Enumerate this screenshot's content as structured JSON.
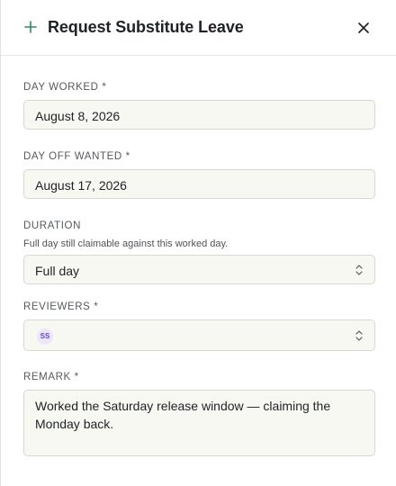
{
  "dialog": {
    "title": "Request Substitute Leave"
  },
  "fields": {
    "day_worked": {
      "label": "DAY WORKED",
      "required_mark": "*",
      "value": "August 8, 2026"
    },
    "day_off": {
      "label": "DAY OFF WANTED",
      "required_mark": "*",
      "value": "August 17, 2026"
    },
    "duration": {
      "label": "DURATION",
      "hint": "Full day still claimable against this worked day.",
      "value": "Full day"
    },
    "reviewers": {
      "label": "REVIEWERS",
      "required_mark": "*",
      "chip": "SS"
    },
    "remark": {
      "label": "REMARK",
      "required_mark": "*",
      "value": "Worked the Saturday release window — claiming the Monday back."
    }
  },
  "icons": {
    "add": "plus-icon",
    "close": "close-icon",
    "select": "chevron-up-down-icon"
  },
  "colors": {
    "accent": "#2e8b57",
    "field_bg": "#f8f8f3",
    "field_border": "#d8d8d2",
    "avatar_bg": "#ece6fb",
    "avatar_text": "#6a45c9"
  }
}
